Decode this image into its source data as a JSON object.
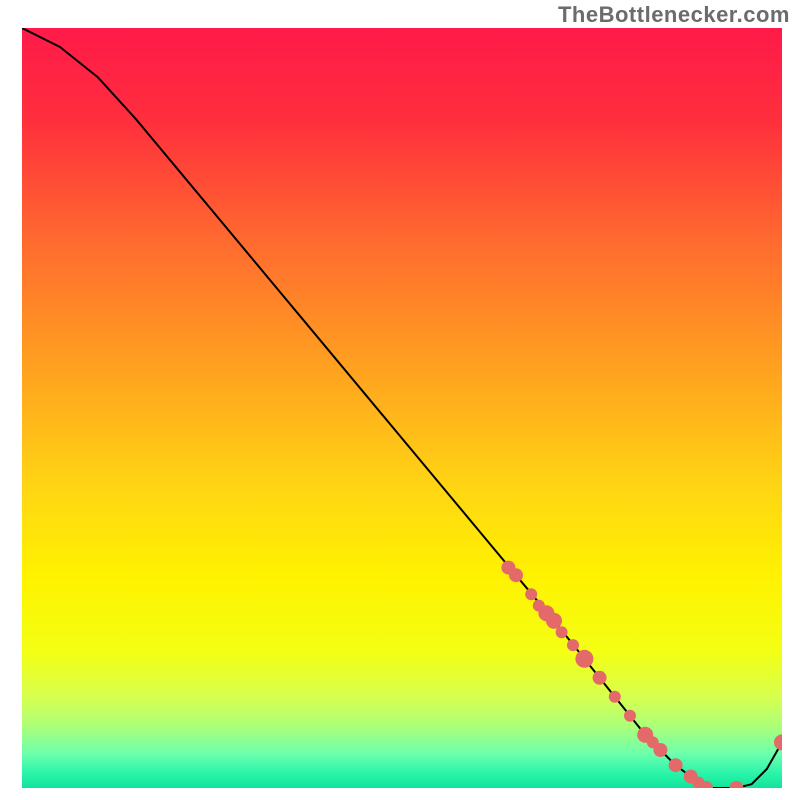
{
  "attribution": "TheBottlenecker.com",
  "chart_data": {
    "type": "line",
    "title": "",
    "xlabel": "",
    "ylabel": "",
    "xlim": [
      0,
      100
    ],
    "ylim": [
      0,
      100
    ],
    "background_gradient": {
      "stops": [
        {
          "offset": 0.0,
          "color": "#ff1a49"
        },
        {
          "offset": 0.12,
          "color": "#ff2e3d"
        },
        {
          "offset": 0.28,
          "color": "#ff6a2f"
        },
        {
          "offset": 0.45,
          "color": "#ffa21f"
        },
        {
          "offset": 0.6,
          "color": "#ffd414"
        },
        {
          "offset": 0.72,
          "color": "#fff200"
        },
        {
          "offset": 0.82,
          "color": "#f4ff13"
        },
        {
          "offset": 0.88,
          "color": "#d7ff4e"
        },
        {
          "offset": 0.92,
          "color": "#aaff7a"
        },
        {
          "offset": 0.955,
          "color": "#6cffad"
        },
        {
          "offset": 0.98,
          "color": "#2bf5aa"
        },
        {
          "offset": 1.0,
          "color": "#12e39b"
        }
      ]
    },
    "series": [
      {
        "name": "bottleneck-curve",
        "x": [
          0,
          5,
          10,
          15,
          20,
          25,
          30,
          35,
          40,
          45,
          50,
          55,
          60,
          65,
          70,
          72,
          74,
          76,
          78,
          80,
          82,
          84,
          86,
          88,
          90,
          92,
          94,
          96,
          98,
          100
        ],
        "y": [
          100,
          97.5,
          93.5,
          88,
          82,
          76,
          70,
          64,
          58,
          52,
          46,
          40,
          34,
          28,
          22,
          19.5,
          17,
          14.5,
          12,
          9.5,
          7,
          5,
          3,
          1.5,
          0,
          0,
          0,
          0.5,
          2.5,
          6
        ]
      }
    ],
    "markers": {
      "name": "highlighted-points",
      "color": "#e46a6a",
      "x": [
        64,
        65,
        67,
        68,
        69,
        70,
        71,
        72.5,
        74,
        76,
        78,
        80,
        82,
        83,
        84,
        86,
        88,
        89,
        90,
        94,
        100
      ],
      "y": [
        29,
        28,
        25.5,
        24,
        23,
        22,
        20.5,
        18.8,
        17,
        14.5,
        12,
        9.5,
        7,
        6,
        5,
        3,
        1.5,
        0.7,
        0,
        0,
        6
      ],
      "r": [
        7,
        7,
        6,
        6,
        8,
        8,
        6,
        6,
        9,
        7,
        6,
        6,
        8,
        6,
        7,
        7,
        7,
        6,
        7,
        7,
        8
      ]
    }
  }
}
